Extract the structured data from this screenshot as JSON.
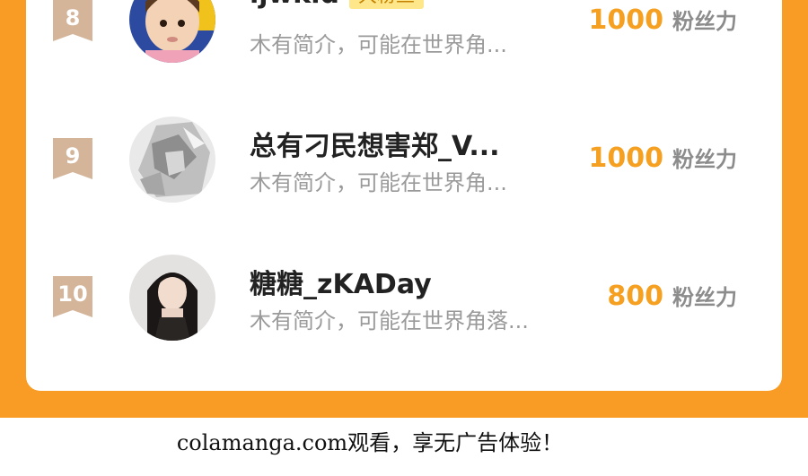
{
  "colors": {
    "background_orange": "#f89c25",
    "rank_badge": "#d4b59a",
    "score_orange": "#f5a020",
    "fan_tag_bg": "#fde78a"
  },
  "rankings": [
    {
      "rank": "8",
      "name": "ljwkid",
      "tag": "大粉丝",
      "bio": "木有简介，可能在世界角...",
      "score": "1000",
      "unit": "粉丝力",
      "avatar_icon": "child-photo-avatar"
    },
    {
      "rank": "9",
      "name": "总有刁民想害郑_V...",
      "bio": "木有简介，可能在世界角...",
      "score": "1000",
      "unit": "粉丝力",
      "avatar_icon": "silver-foil-avatar"
    },
    {
      "rank": "10",
      "name": "糖糖_zKADay",
      "bio": "木有简介，可能在世界角落...",
      "score": "800",
      "unit": "粉丝力",
      "avatar_icon": "woman-portrait-avatar"
    }
  ],
  "footer": {
    "text": "colamanga.com观看，享无广告体验！"
  }
}
